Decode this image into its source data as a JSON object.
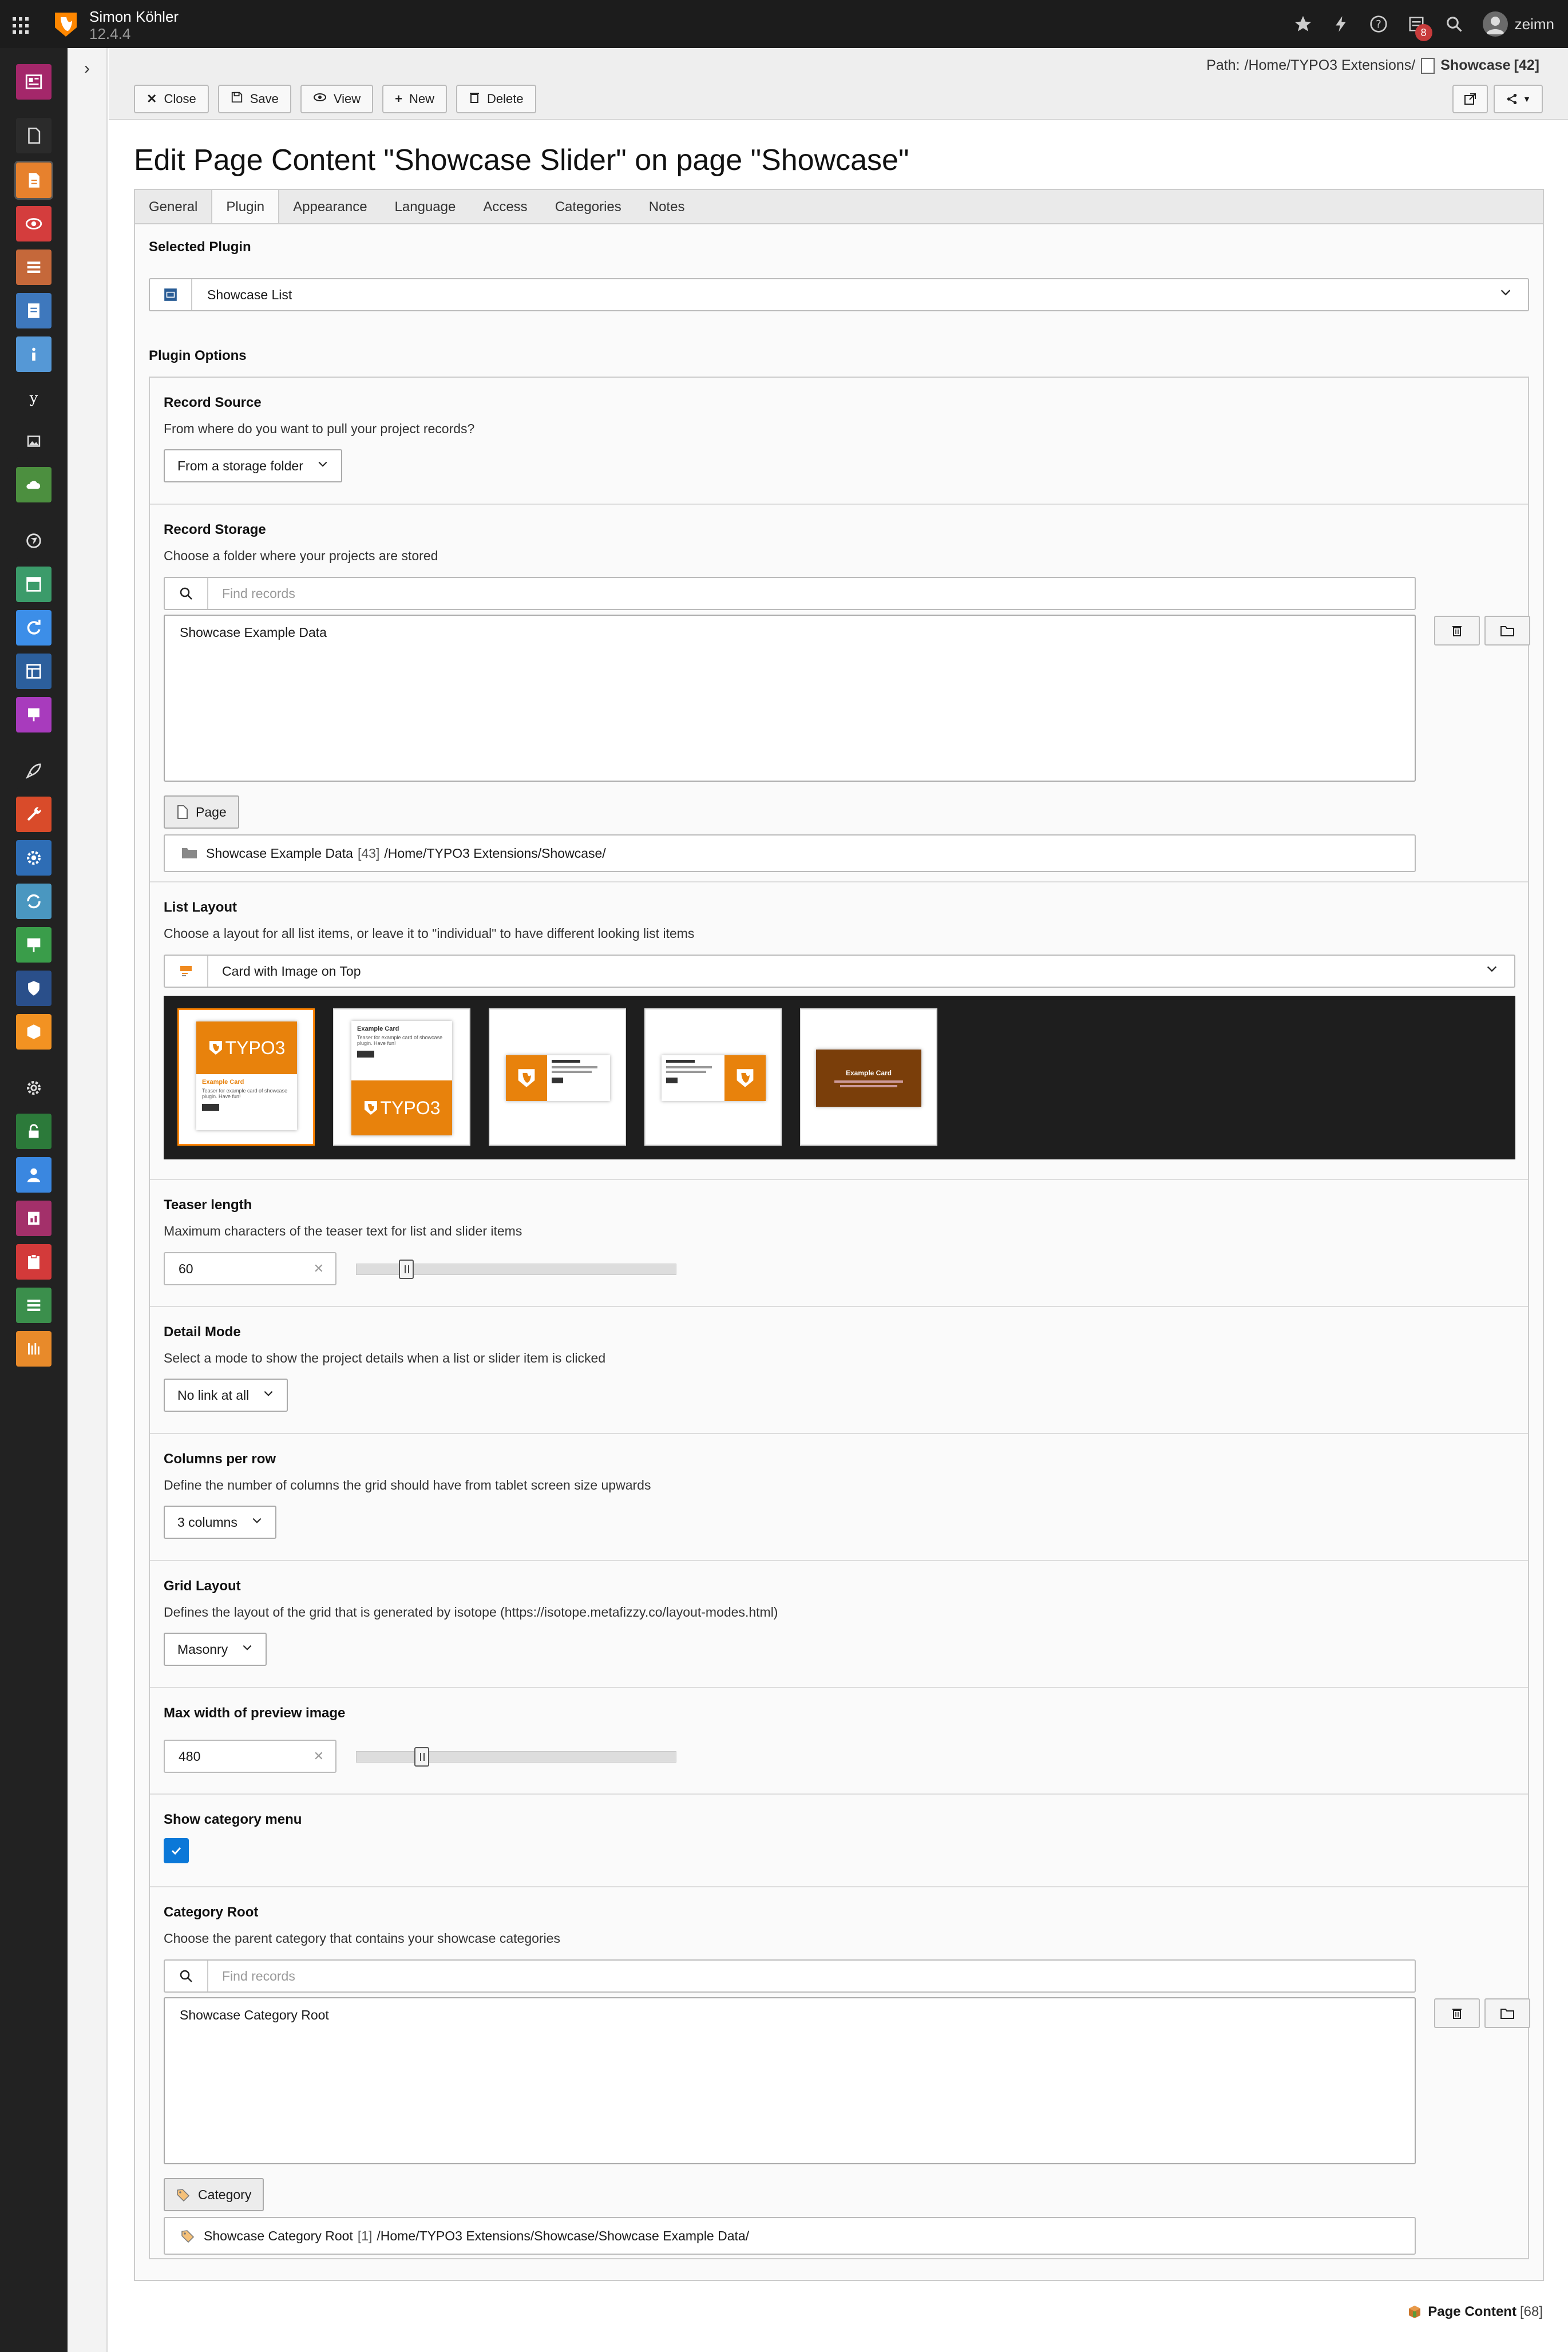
{
  "topbar": {
    "user_name": "Simon Köhler",
    "version": "12.4.4",
    "notification_count": "8",
    "username": "zeimn"
  },
  "docheader": {
    "path_label": "Path:",
    "path_value": "/Home/TYPO3 Extensions/",
    "page_title": "Showcase",
    "page_uid": "[42]",
    "buttons": {
      "close": "Close",
      "save": "Save",
      "view": "View",
      "new": "New",
      "delete": "Delete"
    }
  },
  "main": {
    "title": "Edit Page Content \"Showcase Slider\" on page \"Showcase\"",
    "tabs": [
      "General",
      "Plugin",
      "Appearance",
      "Language",
      "Access",
      "Categories",
      "Notes"
    ],
    "active_tab": "Plugin"
  },
  "plugin": {
    "selected_title": "Selected Plugin",
    "selected_value": "Showcase List",
    "options_title": "Plugin Options"
  },
  "record_source": {
    "label": "Record Source",
    "desc": "From where do you want to pull your project records?",
    "value": "From a storage folder"
  },
  "record_storage": {
    "label": "Record Storage",
    "desc": "Choose a folder where your projects are stored",
    "placeholder": "Find records",
    "selected_item": "Showcase Example Data",
    "type_button": "Page",
    "record_title": "Showcase Example Data",
    "record_uid": "[43]",
    "record_path": "/Home/TYPO3 Extensions/Showcase/"
  },
  "list_layout": {
    "label": "List Layout",
    "desc": "Choose a layout for all list items, or leave it to \"individual\" to have different looking list items",
    "value": "Card with Image on Top",
    "thumb_logo_text": "TYPO3",
    "thumb_card_title": "Example Card",
    "thumb_card_text": "Teaser for example card of showcase plugin. Have fun!"
  },
  "teaser_length": {
    "label": "Teaser length",
    "desc": "Maximum characters of the teaser text for list and slider items",
    "value": "60",
    "slider_fraction": 0.14
  },
  "detail_mode": {
    "label": "Detail Mode",
    "desc": "Select a mode to show the project details when a list or slider item is clicked",
    "value": "No link at all"
  },
  "columns_per_row": {
    "label": "Columns per row",
    "desc": "Define the number of columns the grid should have from tablet screen size upwards",
    "value": "3 columns"
  },
  "grid_layout": {
    "label": "Grid Layout",
    "desc": "Defines the layout of the grid that is generated by isotope (https://isotope.metafizzy.co/layout-modes.html)",
    "value": "Masonry"
  },
  "max_width": {
    "label": "Max width of preview image",
    "value": "480",
    "slider_fraction": 0.19
  },
  "category_menu": {
    "label": "Show category menu",
    "checked": true
  },
  "category_root": {
    "label": "Category Root",
    "desc": "Choose the parent category that contains your showcase categories",
    "placeholder": "Find records",
    "selected_item": "Showcase Category Root",
    "type_button": "Category",
    "record_title": "Showcase Category Root",
    "record_uid": "[1]",
    "record_path": "/Home/TYPO3 Extensions/Showcase/Showcase Example Data/"
  },
  "footer": {
    "record_type": "Page Content",
    "record_uid": "[68]"
  },
  "colors": {
    "accent_orange": "#ff8700",
    "checkbox_blue": "#0b78d8",
    "topbar_bg": "#1c1c1c"
  }
}
